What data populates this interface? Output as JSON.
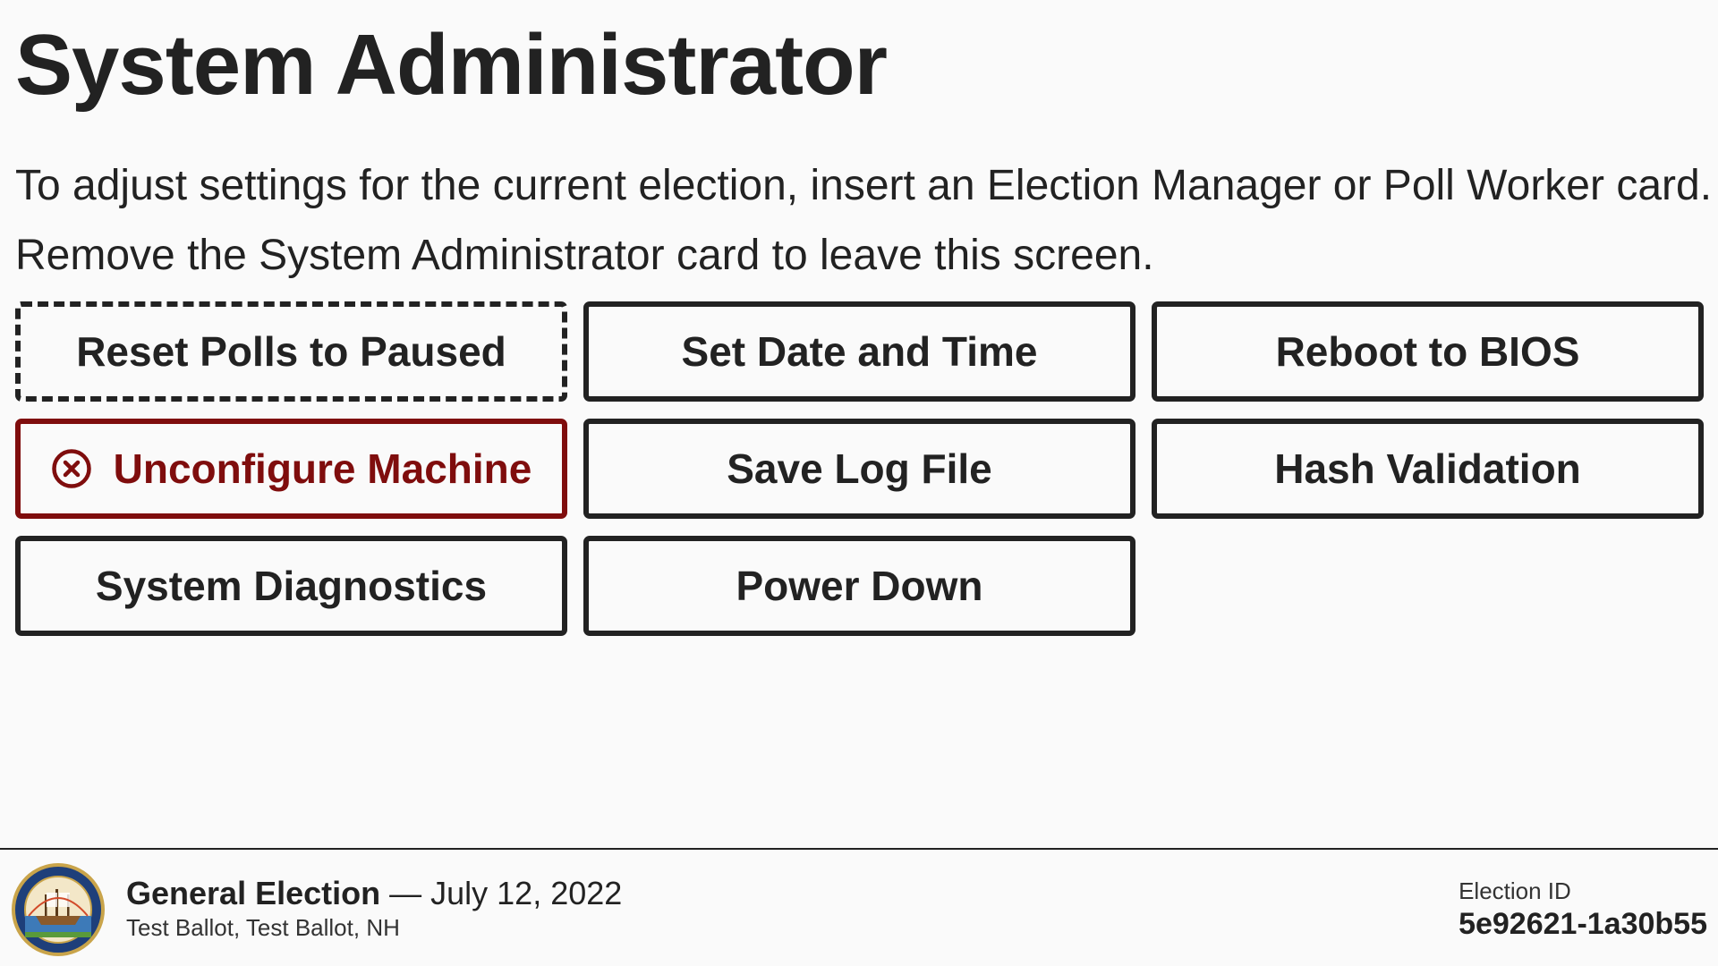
{
  "page": {
    "title": "System Administrator",
    "instruction_line1": "To adjust settings for the current election, insert an Election Manager or Poll Worker card.",
    "instruction_line2": "Remove the System Administrator card to leave this screen."
  },
  "buttons": {
    "reset_polls": "Reset Polls to Paused",
    "set_date_time": "Set Date and Time",
    "reboot_bios": "Reboot to BIOS",
    "unconfigure": "Unconfigure Machine",
    "save_log": "Save Log File",
    "hash_validation": "Hash Validation",
    "system_diagnostics": "System Diagnostics",
    "power_down": "Power Down"
  },
  "colors": {
    "danger": "#7f0d0d",
    "text": "#222222",
    "background": "#fafafa"
  },
  "footer": {
    "election_name": "General Election",
    "separator": " — ",
    "election_date": "July 12, 2022",
    "ballot_info": "Test Ballot, Test Ballot, NH",
    "election_id_label": "Election ID",
    "election_id_value": "5e92621-1a30b55",
    "seal_icon": "state-seal-icon"
  }
}
